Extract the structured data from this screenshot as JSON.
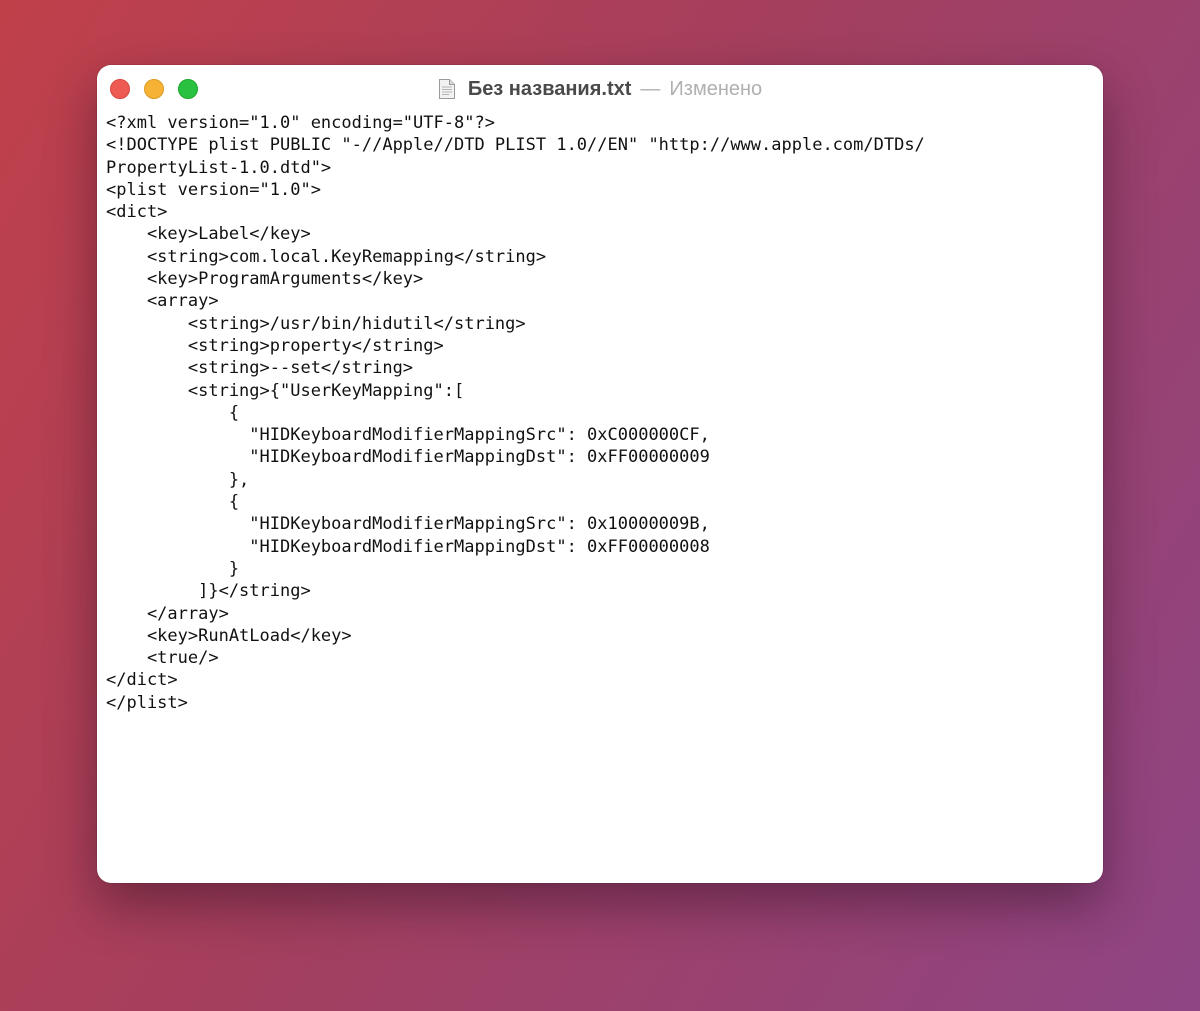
{
  "window": {
    "title": "Без названия.txt",
    "separator": "—",
    "status": "Изменено",
    "document_icon": "text-document-icon",
    "controls": {
      "close": "close-icon",
      "minimize": "minimize-icon",
      "zoom": "zoom-icon"
    },
    "colors": {
      "close": "#ee5b52",
      "minimize": "#f6b234",
      "zoom": "#29c13f"
    }
  },
  "editor": {
    "lines": [
      "<?xml version=\"1.0\" encoding=\"UTF-8\"?>",
      "<!DOCTYPE plist PUBLIC \"-//Apple//DTD PLIST 1.0//EN\" \"http://www.apple.com/DTDs/",
      "PropertyList-1.0.dtd\">",
      "<plist version=\"1.0\">",
      "<dict>",
      "    <key>Label</key>",
      "    <string>com.local.KeyRemapping</string>",
      "    <key>ProgramArguments</key>",
      "    <array>",
      "        <string>/usr/bin/hidutil</string>",
      "        <string>property</string>",
      "        <string>--set</string>",
      "        <string>{\"UserKeyMapping\":[",
      "            {",
      "              \"HIDKeyboardModifierMappingSrc\": 0xC000000CF,",
      "              \"HIDKeyboardModifierMappingDst\": 0xFF00000009",
      "            },",
      "            {",
      "              \"HIDKeyboardModifierMappingSrc\": 0x10000009B,",
      "              \"HIDKeyboardModifierMappingDst\": 0xFF00000008",
      "            }",
      "         ]}</string>",
      "    </array>",
      "    <key>RunAtLoad</key>",
      "    <true/>",
      "</dict>",
      "</plist>"
    ]
  }
}
